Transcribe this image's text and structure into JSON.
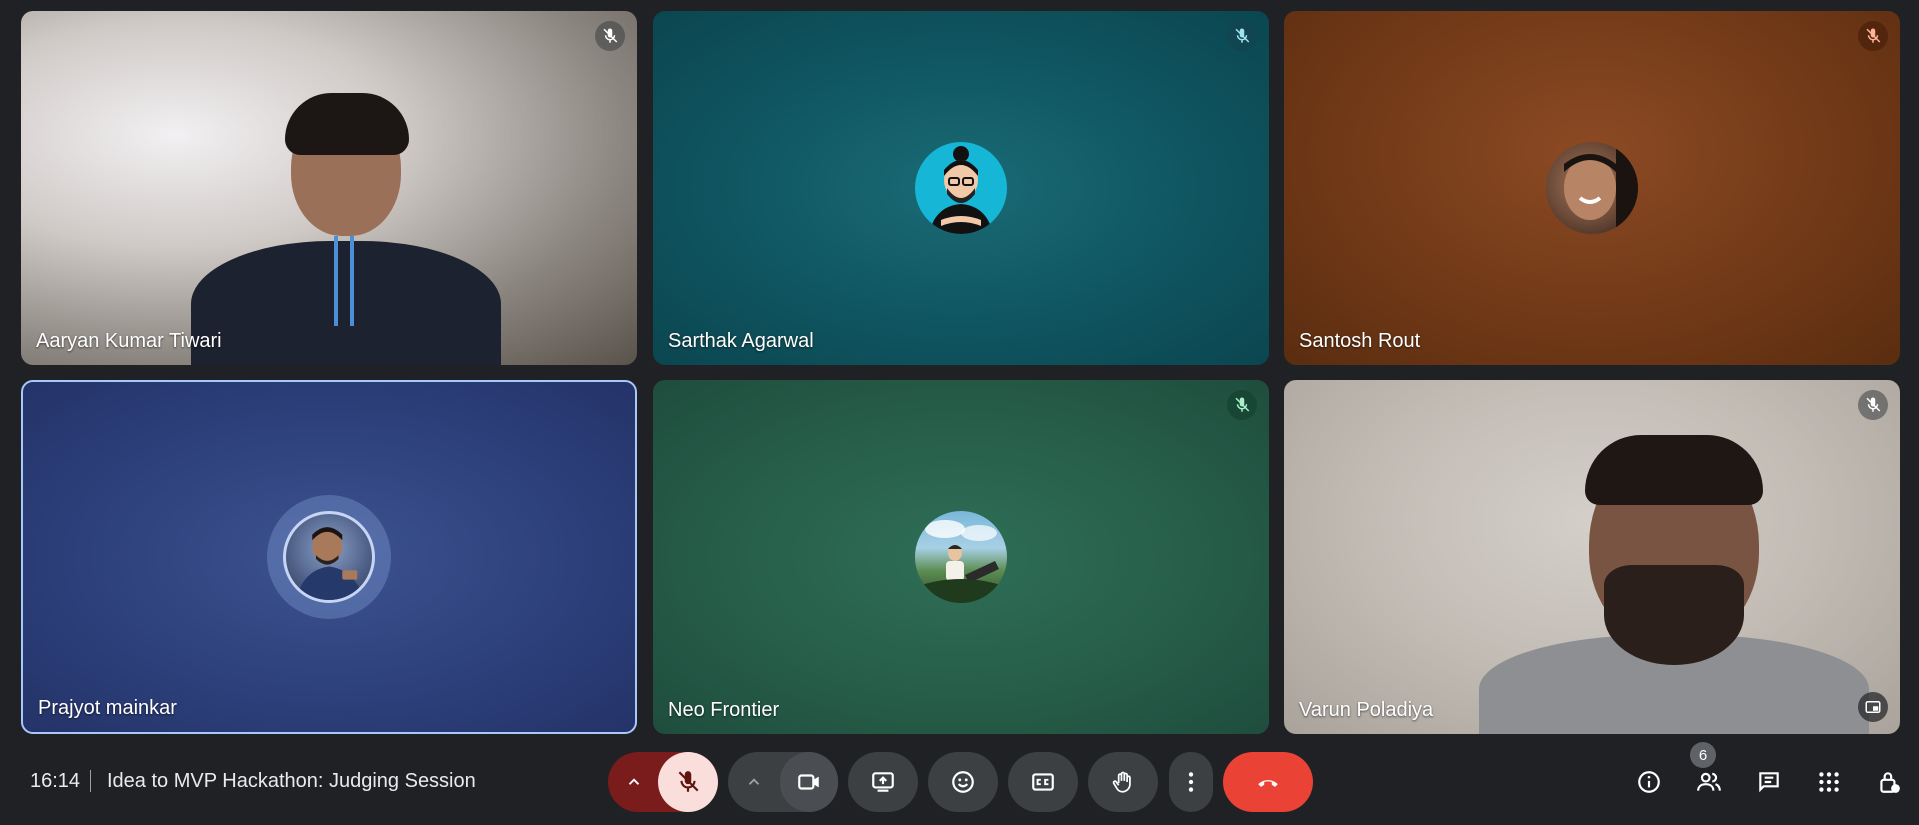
{
  "meeting": {
    "time": "16:14",
    "title": "Idea to MVP Hackathon: Judging Session"
  },
  "participants": [
    {
      "name": "Aaryan Kumar Tiwari",
      "muted": true,
      "media": "video"
    },
    {
      "name": "Sarthak Agarwal",
      "muted": true,
      "media": "avatar"
    },
    {
      "name": "Santosh Rout",
      "muted": true,
      "media": "avatar"
    },
    {
      "name": "Prajyot mainkar",
      "muted": false,
      "media": "avatar",
      "speaking": true
    },
    {
      "name": "Neo Frontier",
      "muted": true,
      "media": "avatar"
    },
    {
      "name": "Varun Poladiya",
      "muted": true,
      "media": "video"
    }
  ],
  "controls": {
    "mic": "mic-off-icon",
    "camera": "video-camera-icon",
    "present": "present-screen-icon",
    "reactions": "emoji-icon",
    "captions": "closed-captions-icon",
    "raise_hand": "hand-icon",
    "more": "more-vert-icon",
    "leave": "end-call-icon"
  },
  "side_panel": {
    "people_count": "6",
    "icons": [
      "info-icon",
      "people-icon",
      "chat-icon",
      "apps-icon",
      "host-controls-icon"
    ]
  },
  "colors": {
    "background": "#202124",
    "end_call": "#ea4335",
    "mic_muted_bg": "#f9dedc",
    "speaking_border": "#a8c7fa"
  }
}
